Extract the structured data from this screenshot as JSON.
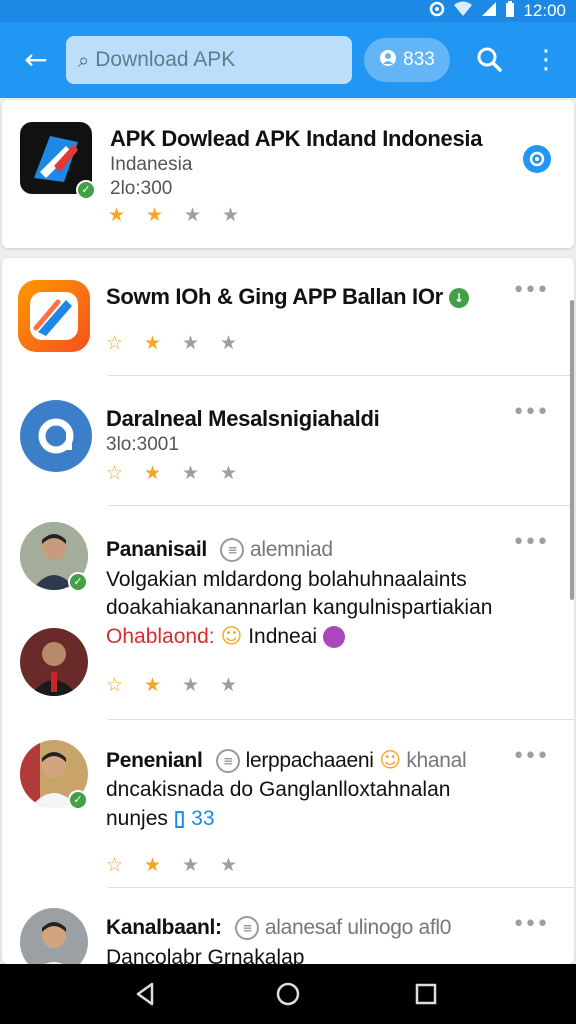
{
  "status_bar": {
    "time": "12:00",
    "wifi_icon": "wifi-icon",
    "signal_icon": "signal-icon",
    "battery_icon": "battery-icon"
  },
  "app_bar": {
    "back_icon": "arrow-left-icon",
    "search": {
      "value": "Download APK",
      "placeholder": "Download APK"
    },
    "chip": {
      "icon": "user-icon",
      "label": "833"
    },
    "search_icon": "search-icon",
    "menu_icon": "more-vert-icon"
  },
  "featured": {
    "title": "APK Dowlead APK Indand Indonesia",
    "subtitle": "Indanesia",
    "count": "2lo:300",
    "rating": 2,
    "verified_icon": "verified-badge-icon"
  },
  "results": [
    {
      "type": "app",
      "title": "Sowm IOh & Ging APP Ballan IOr",
      "rating": 1,
      "has_half": true,
      "verified": true
    },
    {
      "type": "app",
      "title": "Daralneal Mesalsnigiahaldi",
      "subtitle": "3lo:3001",
      "rating": 1,
      "has_half": true
    },
    {
      "type": "review",
      "name": "Pananisail",
      "handle": "alemniad",
      "line1": "Volgakian mldardong bolahuhnaalaints",
      "line2": "doakahiakanannarlan kangulnispartiakian",
      "line3_red": "Ohablaond:",
      "line3_rest": "Indneai",
      "rating": 1,
      "has_half": true
    },
    {
      "type": "review",
      "name": "Penenianl",
      "handle": "lerppachaaeni",
      "handle_tail": "khanal",
      "line1": "dncakisnada do Ganglanlloxtahnalan",
      "line2": "nunjes",
      "line2_tag": "33",
      "rating": 1,
      "has_half": true
    },
    {
      "type": "review",
      "name": "Kanalbaanl:",
      "handle": "alanesaf ulinogo afl0",
      "line1": "Dancolabr Grnakalap"
    }
  ],
  "nav": {
    "back": "nav-back-icon",
    "home": "nav-home-icon",
    "recents": "nav-recents-icon"
  },
  "colors": {
    "primary": "#2196f3",
    "status": "#1e88e5",
    "star": "#f5a623",
    "verified": "#43a047"
  }
}
